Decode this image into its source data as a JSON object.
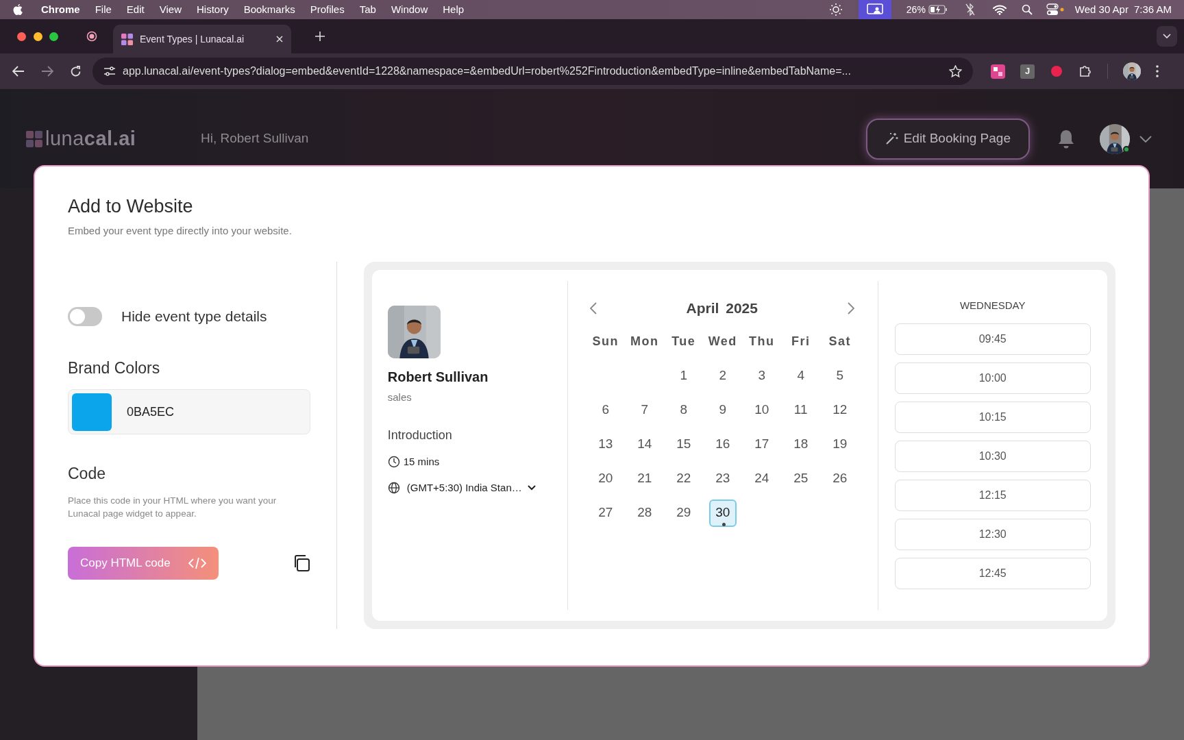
{
  "menubar": {
    "app": "Chrome",
    "menus": [
      "File",
      "Edit",
      "View",
      "History",
      "Bookmarks",
      "Profiles",
      "Tab",
      "Window",
      "Help"
    ],
    "battery": "26%",
    "date": "Wed 30 Apr",
    "time": "7:36 AM"
  },
  "browser": {
    "tab_title": "Event Types | Lunacal.ai",
    "url": "app.lunacal.ai/event-types?dialog=embed&eventId=1228&namespace=&embedUrl=robert%252Fintroduction&embedType=inline&embedTabName=...",
    "extension_letter": "J"
  },
  "app": {
    "logo": "luna**cal.ai**",
    "greeting": "Hi, Robert Sullivan",
    "edit_button": "Edit Booking Page"
  },
  "modal": {
    "title": "Add to Website",
    "subtitle": "Embed your event type directly into your website.",
    "toggle": {
      "label": "Hide event type details",
      "on": false
    },
    "brand_colors": {
      "heading": "Brand Colors",
      "value": "0BA5EC",
      "color": "#0ba5ec"
    },
    "code": {
      "heading": "Code",
      "hint": "Place this code in your HTML where you want your Lunacal page widget to appear.",
      "button": "Copy HTML code"
    }
  },
  "preview": {
    "host": {
      "name": "Robert Sullivan",
      "team": "sales"
    },
    "event": {
      "title": "Introduction",
      "duration": "15 mins",
      "timezone": "(GMT+5:30) India Stan…"
    },
    "calendar": {
      "month": "April",
      "year": "2025",
      "weekdays": [
        "Sun",
        "Mon",
        "Tue",
        "Wed",
        "Thu",
        "Fri",
        "Sat"
      ],
      "weeks": [
        {
          "days": [
            {
              "kind": "blank"
            },
            {
              "kind": "blank"
            },
            {
              "label": "1",
              "selected": false,
              "dot": false
            },
            {
              "label": "2",
              "selected": false,
              "dot": false
            },
            {
              "label": "3",
              "selected": false,
              "dot": false
            },
            {
              "label": "4",
              "selected": false,
              "dot": false
            },
            {
              "label": "5",
              "selected": false,
              "dot": false
            }
          ]
        },
        {
          "days": [
            {
              "label": "6",
              "selected": false,
              "dot": false
            },
            {
              "label": "7",
              "selected": false,
              "dot": false
            },
            {
              "label": "8",
              "selected": false,
              "dot": false
            },
            {
              "label": "9",
              "selected": false,
              "dot": false
            },
            {
              "label": "10",
              "selected": false,
              "dot": false
            },
            {
              "label": "11",
              "selected": false,
              "dot": false
            },
            {
              "label": "12",
              "selected": false,
              "dot": false
            }
          ]
        },
        {
          "days": [
            {
              "label": "13",
              "selected": false,
              "dot": false
            },
            {
              "label": "14",
              "selected": false,
              "dot": false
            },
            {
              "label": "15",
              "selected": false,
              "dot": false
            },
            {
              "label": "16",
              "selected": false,
              "dot": false
            },
            {
              "label": "17",
              "selected": false,
              "dot": false
            },
            {
              "label": "18",
              "selected": false,
              "dot": false
            },
            {
              "label": "19",
              "selected": false,
              "dot": false
            }
          ]
        },
        {
          "days": [
            {
              "label": "20",
              "selected": false,
              "dot": false
            },
            {
              "label": "21",
              "selected": false,
              "dot": false
            },
            {
              "label": "22",
              "selected": false,
              "dot": false
            },
            {
              "label": "23",
              "selected": false,
              "dot": false
            },
            {
              "label": "24",
              "selected": false,
              "dot": false
            },
            {
              "label": "25",
              "selected": false,
              "dot": false
            },
            {
              "label": "26",
              "selected": false,
              "dot": false
            }
          ]
        },
        {
          "days": [
            {
              "label": "27",
              "selected": false,
              "dot": false
            },
            {
              "label": "28",
              "selected": false,
              "dot": false
            },
            {
              "label": "29",
              "selected": false,
              "dot": false
            },
            {
              "label": "30",
              "selected": true,
              "dot": true
            }
          ]
        }
      ]
    },
    "slots": {
      "day": "WEDNESDAY",
      "times": [
        "09:45",
        "10:00",
        "10:15",
        "10:30",
        "12:15",
        "12:30",
        "12:45"
      ]
    }
  }
}
